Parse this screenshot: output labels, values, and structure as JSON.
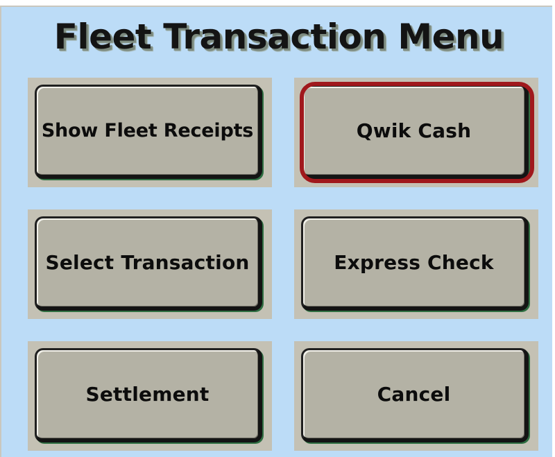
{
  "menu": {
    "title": "Fleet Transaction Menu",
    "buttons": [
      {
        "label": "Show Fleet Receipts"
      },
      {
        "label": "Qwik Cash",
        "highlighted": true
      },
      {
        "label": "Select Transaction"
      },
      {
        "label": "Express Check"
      },
      {
        "label": "Settlement"
      },
      {
        "label": "Cancel"
      }
    ]
  },
  "colors": {
    "background": "#bcdcf7",
    "button_face": "#b4b2a5",
    "highlight_ring": "#a0181c"
  }
}
